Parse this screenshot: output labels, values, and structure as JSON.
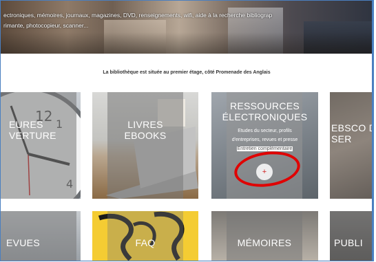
{
  "banner": {
    "line1": "ectroniques, mémoires, journaux, magazines, DVD, renseignements, wifi, aide à la recherche bibliograp",
    "line2": "rimante, photocopieur, scanner..."
  },
  "location_text": "La bibliothèque est située au premier étage, côté Promenade des Anglais",
  "tiles": [
    {
      "label": "EURES\nVERTURE"
    },
    {
      "label": "LIVRES\nEBOOKS"
    },
    {
      "label": "RESSOURCES\nÉLECTRONIQUES"
    },
    {
      "label": "EBSCO D\nSER"
    },
    {
      "label": "EVUES"
    },
    {
      "label": "FAQ"
    },
    {
      "label": "MÉMOIRES"
    },
    {
      "label": "PUBLI"
    }
  ],
  "ressources_desc": {
    "line1": "Etudes du secteur, profils",
    "line2": "d'entreprises, revues et presse",
    "line3": "Entretien complémentaire"
  },
  "plus_button_glyph": "+",
  "colors": {
    "annotation_circle": "#e00000",
    "frame_border": "#4a7fc0",
    "faq_tile": "#f4cc33"
  }
}
